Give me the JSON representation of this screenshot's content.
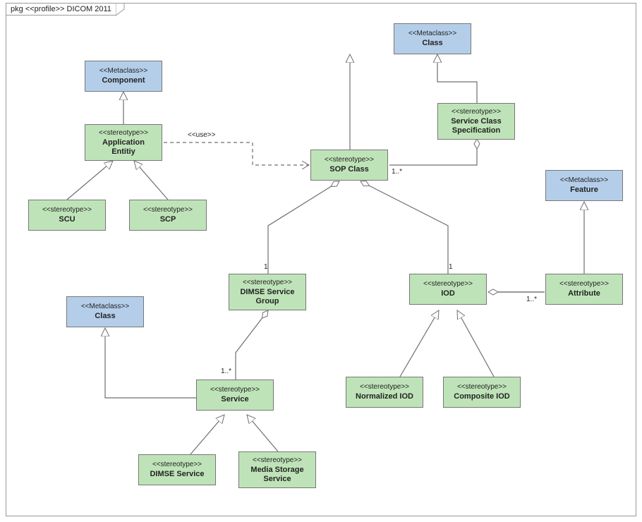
{
  "package": {
    "kind": "pkg",
    "stereotype": "<<profile>>",
    "name": "DICOM 2011"
  },
  "nodes": {
    "meta_component": {
      "tag": "<<Metaclass>>",
      "name": "Component"
    },
    "meta_class_top": {
      "tag": "<<Metaclass>>",
      "name": "Class"
    },
    "meta_feature": {
      "tag": "<<Metaclass>>",
      "name": "Feature"
    },
    "meta_class_left": {
      "tag": "<<Metaclass>>",
      "name": "Class"
    },
    "s_app_entity": {
      "tag": "<<stereotype>>",
      "name": "Application Entitiy"
    },
    "s_scu": {
      "tag": "<<stereotype>>",
      "name": "SCU"
    },
    "s_scp": {
      "tag": "<<stereotype>>",
      "name": "SCP"
    },
    "s_svc_class_spec": {
      "tag": "<<stereotype>>",
      "name": "Service Class Specification"
    },
    "s_sop_class": {
      "tag": "<<stereotype>>",
      "name": "SOP Class"
    },
    "s_dimse_group": {
      "tag": "<<stereotype>>",
      "name": "DIMSE Service Group"
    },
    "s_iod": {
      "tag": "<<stereotype>>",
      "name": "IOD"
    },
    "s_attribute": {
      "tag": "<<stereotype>>",
      "name": "Attribute"
    },
    "s_service": {
      "tag": "<<stereotype>>",
      "name": "Service"
    },
    "s_norm_iod": {
      "tag": "<<stereotype>>",
      "name": "Normalized IOD"
    },
    "s_comp_iod": {
      "tag": "<<stereotype>>",
      "name": "Composite IOD"
    },
    "s_dimse_service": {
      "tag": "<<stereotype>>",
      "name": "DIMSE Service"
    },
    "s_media_storage": {
      "tag": "<<stereotype>>",
      "name": "Media Storage Service"
    }
  },
  "labels": {
    "use": "<<use>>",
    "one_a": "1",
    "one_b": "1",
    "one_star_a": "1..*",
    "one_star_b": "1..*",
    "one_star_c": "1..*"
  },
  "chart_data": {
    "type": "uml-profile-diagram",
    "package": "DICOM 2011",
    "metaclasses": [
      "Component",
      "Class",
      "Feature"
    ],
    "stereotypes": [
      "Application Entitiy",
      "SCU",
      "SCP",
      "Service Class Specification",
      "SOP Class",
      "DIMSE Service Group",
      "IOD",
      "Attribute",
      "Service",
      "Normalized IOD",
      "Composite IOD",
      "DIMSE Service",
      "Media Storage Service"
    ],
    "extensions": [
      {
        "stereotype": "Application Entitiy",
        "metaclass": "Component"
      },
      {
        "stereotype": "SOP Class",
        "metaclass": "Class"
      },
      {
        "stereotype": "Service Class Specification",
        "metaclass": "Class"
      },
      {
        "stereotype": "Attribute",
        "metaclass": "Feature"
      },
      {
        "stereotype": "Service",
        "metaclass": "Class"
      }
    ],
    "generalizations": [
      {
        "child": "SCU",
        "parent": "Application Entitiy"
      },
      {
        "child": "SCP",
        "parent": "Application Entitiy"
      },
      {
        "child": "Normalized IOD",
        "parent": "IOD"
      },
      {
        "child": "Composite IOD",
        "parent": "IOD"
      },
      {
        "child": "DIMSE Service",
        "parent": "Service"
      },
      {
        "child": "Media Storage Service",
        "parent": "Service"
      }
    ],
    "aggregations": [
      {
        "whole": "SOP Class",
        "part": "DIMSE Service Group",
        "multiplicity": "1"
      },
      {
        "whole": "SOP Class",
        "part": "IOD",
        "multiplicity": "1"
      },
      {
        "whole": "DIMSE Service Group",
        "part": "Service",
        "multiplicity": "1..*"
      },
      {
        "whole": "IOD",
        "part": "Attribute",
        "multiplicity": "1..*"
      },
      {
        "whole": "Service Class Specification",
        "part": "SOP Class",
        "multiplicity": "1..*"
      }
    ],
    "dependencies": [
      {
        "client": "Application Entitiy",
        "supplier": "SOP Class",
        "stereotype": "use"
      }
    ]
  }
}
